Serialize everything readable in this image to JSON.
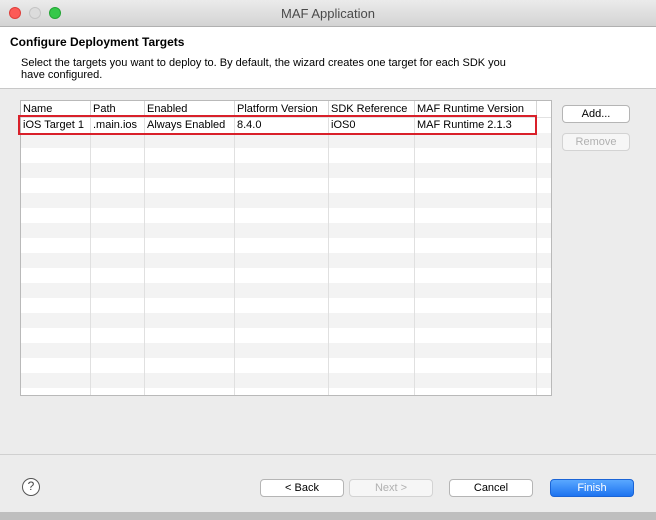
{
  "window": {
    "title": "MAF Application"
  },
  "header": {
    "title": "Configure Deployment Targets",
    "description": "Select the targets you want to deploy to.  By default, the wizard creates one target for each SDK you have configured."
  },
  "table": {
    "columns": [
      "Name",
      "Path",
      "Enabled",
      "Platform Version",
      "SDK Reference",
      "MAF Runtime Version",
      ""
    ],
    "rows": [
      [
        "iOS Target 1",
        ".main.ios",
        "Always Enabled",
        "8.4.0",
        "iOS0",
        "MAF Runtime 2.1.3",
        ""
      ]
    ]
  },
  "side_buttons": {
    "add": "Add...",
    "remove": "Remove"
  },
  "footer": {
    "help": "?",
    "back": "< Back",
    "next": "Next >",
    "cancel": "Cancel",
    "finish": "Finish"
  },
  "colors": {
    "highlight": "#d9202a",
    "primary": "#1d73f0"
  }
}
